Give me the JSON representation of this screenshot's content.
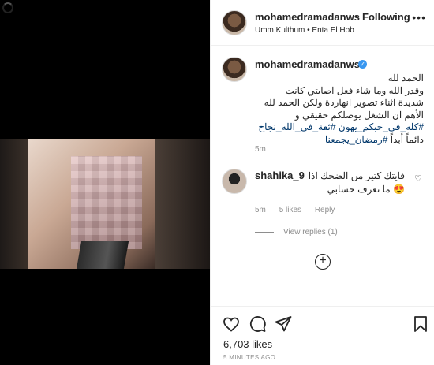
{
  "post": {
    "username": "mohamedramadanws",
    "separator": "•",
    "follow_label": "Following",
    "music": "Umm Kulthum • Enta El Hob",
    "more_icon": "more-horizontal-icon"
  },
  "caption": {
    "username": "mohamedramadanws",
    "verified_icon": "verified-badge-icon",
    "lines": [
      "الحمد لله",
      "وقدر الله وما شاء فعل اصابتي كانت",
      "شديدة اثناء تصوير انهاردة ولكن الحمد لله",
      "الأهم ان الشغل يوصلكم حقيقي و"
    ],
    "hashtags_line1": "#كله_في_حبكم_يهون #ثقة_في_الله_نجاح",
    "hashtags_line2_prefix": "دائماً أبداً ",
    "hashtags_line2_tag": "#رمضان_يجمعنا",
    "time": "5m"
  },
  "comment": {
    "username": "shahika_9",
    "text_line1": "فايتك كتير من الضحك اذا",
    "text_line2": "😍 ما تعرف حسابي",
    "time": "5m",
    "likes": "5 likes",
    "reply": "Reply",
    "view_replies": "View replies (1)"
  },
  "footer": {
    "likes": "6,703 likes",
    "time_ago": "5 MINUTES AGO"
  },
  "colors": {
    "link": "#00376b",
    "muted": "#8e8e8e",
    "verified": "#3897f0",
    "text": "#262626"
  }
}
